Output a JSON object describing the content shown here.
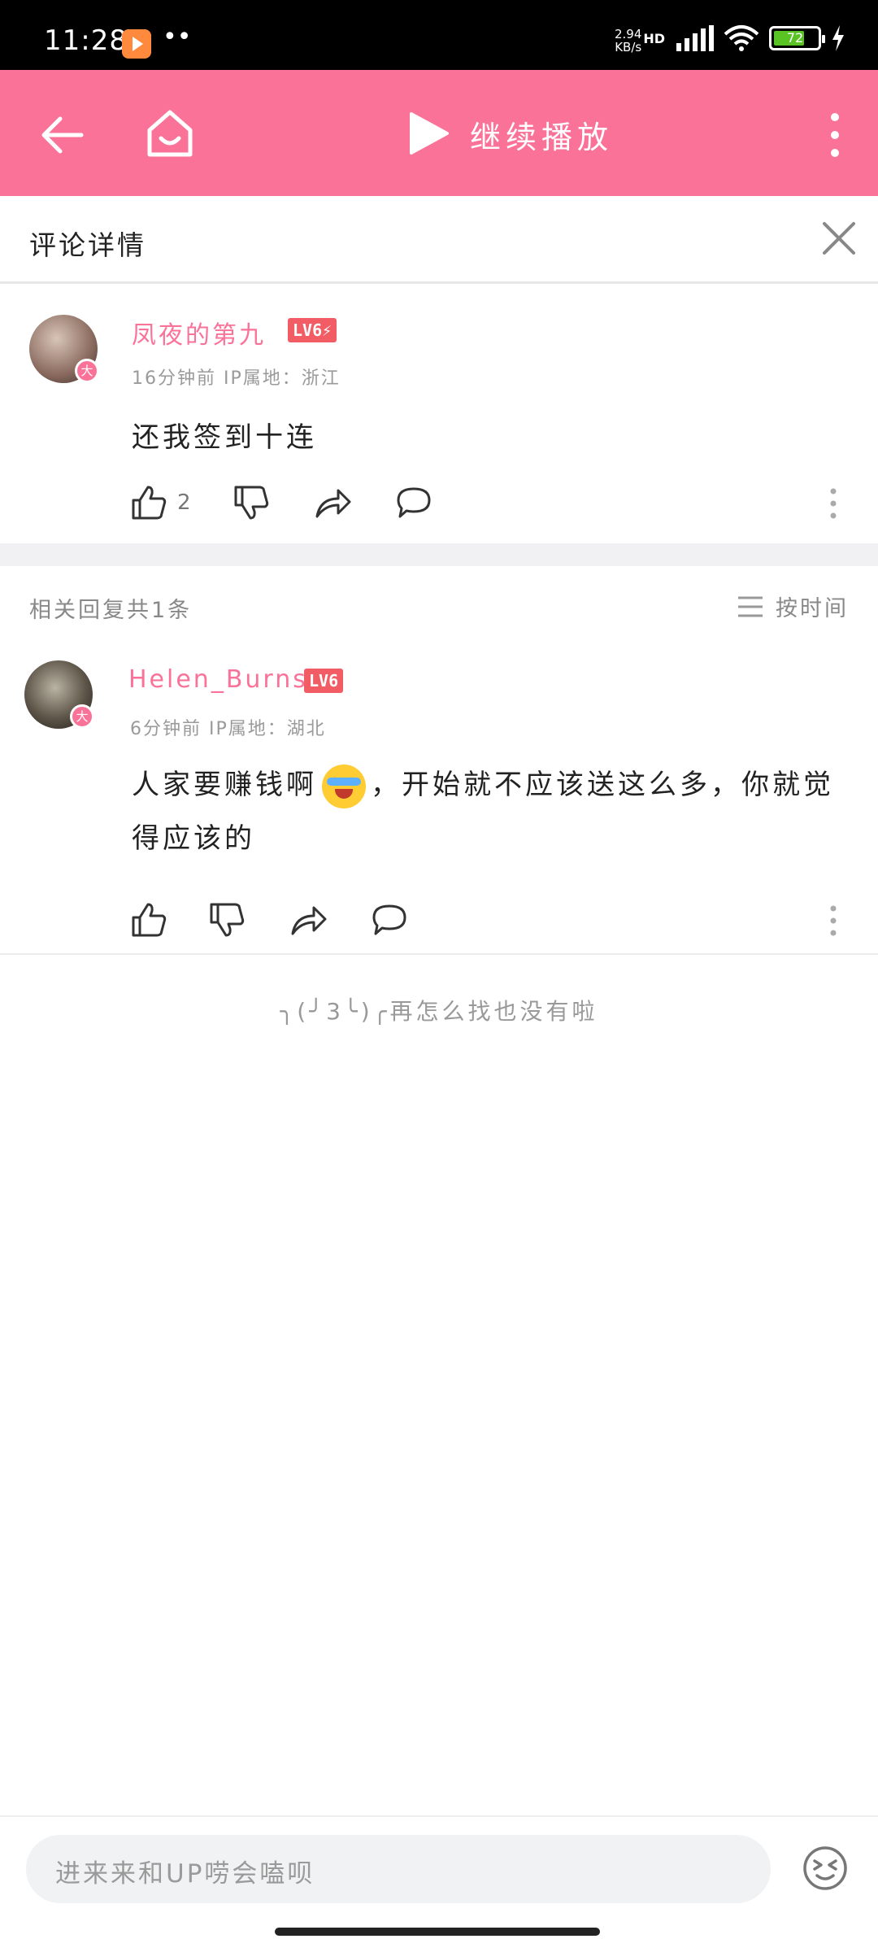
{
  "status_bar": {
    "time": "11:28",
    "dots": "••",
    "net_speed_value": "2.94",
    "net_speed_unit": "KB/s",
    "hd_label": "HD",
    "battery": "72",
    "battery_level": 0.72,
    "battery_color": "#58c322"
  },
  "header": {
    "title": "继续播放",
    "accent": "#fb7299"
  },
  "detail": {
    "title": "评论详情"
  },
  "root_comment": {
    "user": "凤夜的第九",
    "level": "LV6",
    "level_suffix": "⚡",
    "vip": "大",
    "meta": "16分钟前  IP属地：浙江",
    "text": "还我签到十连",
    "likes": "2"
  },
  "replies_header": {
    "label": "相关回复共1条",
    "sort_label": "按时间"
  },
  "reply": {
    "user": "Helen_Burns",
    "level": "LV6",
    "vip": "大",
    "meta": "6分钟前  IP属地：湖北",
    "text_part1": "人家要赚钱啊",
    "emoji": "laughing-crying-emoji",
    "text_part2": "，开始就不应该送这么多，你就觉得应该的"
  },
  "end_message": "╮(╯3╰)╭再怎么找也没有啦",
  "bottom": {
    "input_placeholder": "进来来和UP唠会嗑呗"
  }
}
